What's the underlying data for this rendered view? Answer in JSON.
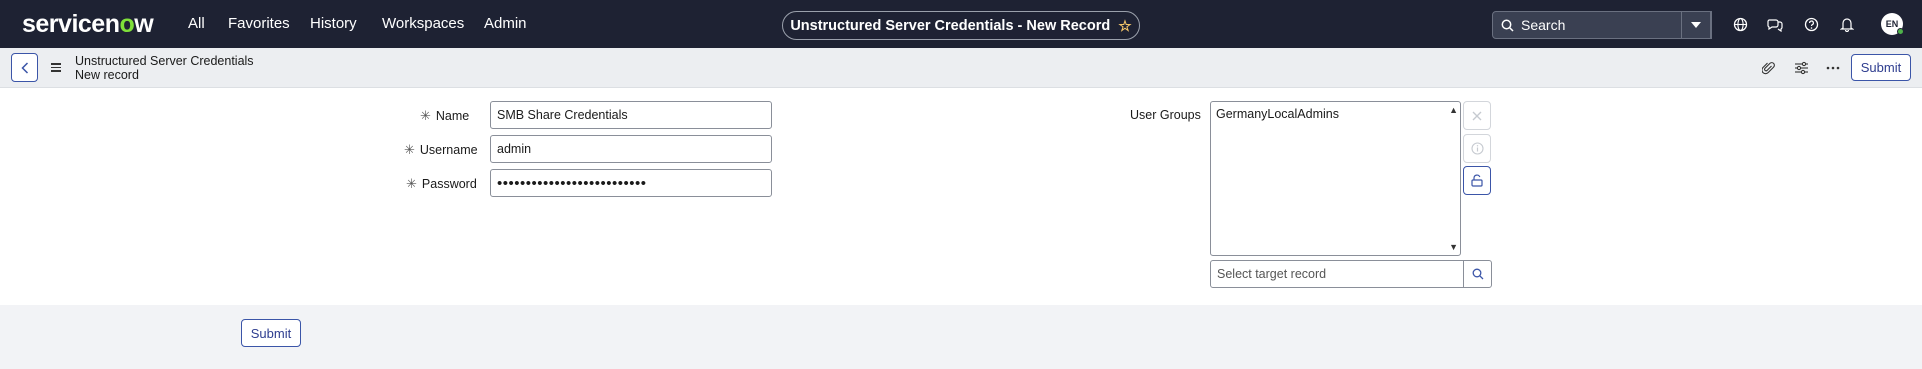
{
  "topbar": {
    "logo": {
      "text_a": "servicen",
      "text_o": "o",
      "text_b": "w"
    },
    "nav": [
      "All",
      "Favorites",
      "History",
      "Workspaces",
      "Admin"
    ],
    "record_title": "Unstructured Server Credentials - New Record",
    "search_placeholder": "Search",
    "avatar_initials": "EN",
    "icons": [
      "globe-icon",
      "chat-icon",
      "help-icon",
      "bell-icon"
    ],
    "status_color": "#4fb34b"
  },
  "header": {
    "table_name": "Unstructured Server Credentials",
    "record_label": "New record",
    "submit_label": "Submit",
    "icons": [
      "attachment-icon",
      "settings-sliders-icon",
      "more-icon"
    ]
  },
  "form": {
    "name_label": "Name",
    "name_value": "SMB Share Credentials",
    "username_label": "Username",
    "username_value": "admin",
    "password_label": "Password",
    "password_value": "••••••••••••••••••••••••••",
    "user_groups_label": "User Groups",
    "user_groups_items": [
      "GermanyLocalAdmins"
    ],
    "target_placeholder": "Select target record",
    "required_marker": "✳"
  },
  "footer": {
    "submit_label": "Submit"
  },
  "colors": {
    "nav_bg": "#1e2233",
    "accent": "#3b55a8",
    "logo_green": "#7fe03a"
  }
}
